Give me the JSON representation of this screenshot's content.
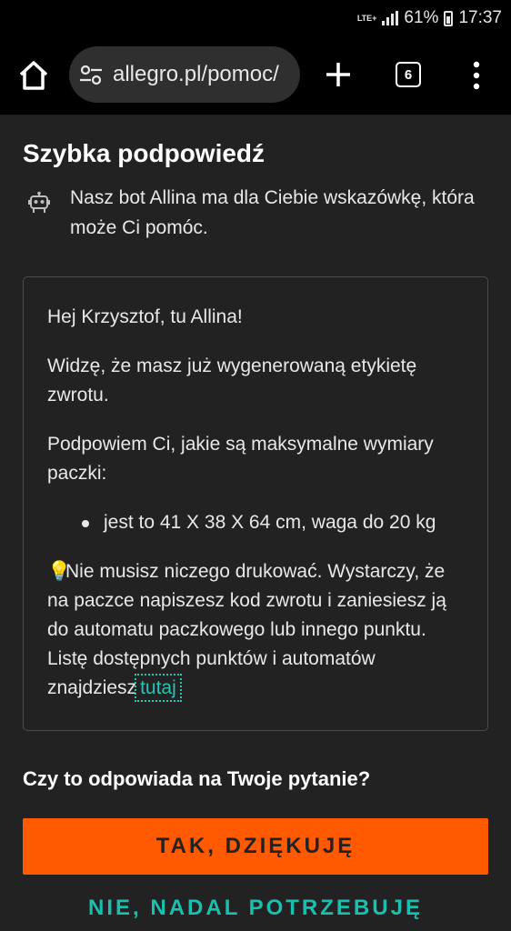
{
  "status_bar": {
    "network": "LTE+",
    "battery_percent": "61%",
    "time": "17:37"
  },
  "browser": {
    "url": "allegro.pl/pomoc/",
    "tab_count": "6",
    "icons": [
      "home-icon",
      "site-settings-icon",
      "new-tab-icon",
      "tab-switcher-icon",
      "more-menu-icon"
    ]
  },
  "hint": {
    "title": "Szybka podpowiedź",
    "intro": "Nasz bot Allina ma dla Ciebie wskazówkę, która może Ci pomóc.",
    "greeting": "Hej Krzysztof, tu Allina!",
    "label_info": "Widzę, że masz już wygenerowaną etykietę zwrotu.",
    "dimensions_intro": "Podpowiem Ci, jakie są maksymalne wymiary paczki:",
    "dimensions_item": "jest to 41 X 38 X 64 cm, waga do 20 kg",
    "bulb_icon": "💡",
    "tip_text": "Nie musisz niczego drukować. Wystarczy, że na paczce napiszesz kod zwrotu i zaniesiesz ją do automatu paczkowego lub innego punktu. Listę dostępnych punktów i automatów znajdziesz",
    "tip_link": "tutaj"
  },
  "feedback": {
    "question": "Czy to odpowiada na Twoje pytanie?",
    "yes_label": "TAK, DZIĘKUJĘ",
    "no_label": "NIE, NADAL POTRZEBUJĘ"
  },
  "colors": {
    "accent": "#ff5a00",
    "link": "#27c4b5",
    "background": "#222222"
  }
}
